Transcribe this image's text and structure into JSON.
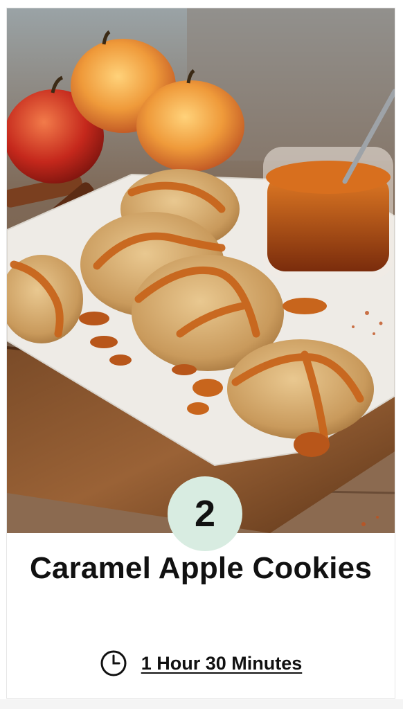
{
  "recipe": {
    "number": "2",
    "title": "Caramel Apple Cookies",
    "time": "1 Hour 30 Minutes"
  },
  "icons": {
    "time_icon": "clock-icon"
  },
  "colors": {
    "badge_bg": "#d8ece1",
    "text": "#111111",
    "caramel": "#c86a1c"
  }
}
